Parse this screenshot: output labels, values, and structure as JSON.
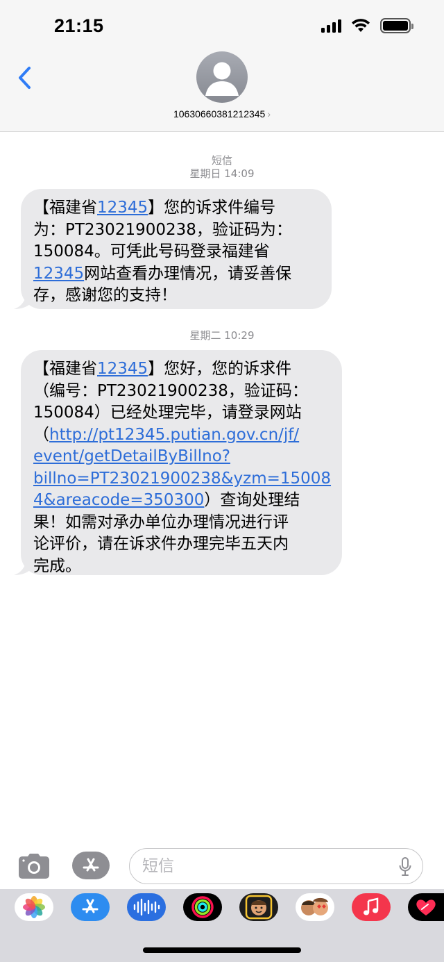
{
  "status_bar": {
    "time": "21:15"
  },
  "header": {
    "contact": "10630660381212345",
    "back_icon": "chevron-left-icon",
    "avatar_icon": "person-icon"
  },
  "thread": {
    "service_label": "短信",
    "timestamp_1": "星期日 14:09",
    "message_1": {
      "l1_a": "【福建省",
      "l1_link": "12345",
      "l1_b": "】您的诉求件编号",
      "l2": "为：PT23021900238，验证码为：",
      "l3": "150084。可凭此号码登录福建省",
      "l4_link": "12345",
      "l4_b": "网站查看办理情况，请妥善保",
      "l5": "存，感谢您的支持！"
    },
    "timestamp_2": "星期二 10:29",
    "message_2": {
      "l1_a": "【福建省",
      "l1_link": "12345",
      "l1_b": "】您好，您的诉求件",
      "l2": "（编号：PT23021900238，验证码：",
      "l3": "150084）已经处理完毕，请登录网站",
      "l4_a": "（",
      "l4_link": "http://pt12345.putian.gov.cn/jf/",
      "l5_link": "event/getDetailByBillno?",
      "l6_link": "billno=PT23021900238&yzm=15008",
      "l7_link": "4&areacode=350300",
      "l7_b": "）查询处理结",
      "l8": "果！如需对承办单位办理情况进行评",
      "l9": "论评价，请在诉求件办理完毕五天内",
      "l10": "完成。"
    }
  },
  "compose": {
    "placeholder": "短信",
    "camera_icon": "camera-icon",
    "apps_icon": "app-store-icon",
    "mic_icon": "microphone-icon"
  },
  "app_strip": [
    "photos-icon",
    "app-store-icon",
    "audio-message-icon",
    "activity-icon",
    "memoji-icon",
    "memoji-stickers-icon",
    "music-icon",
    "digital-touch-icon"
  ],
  "colors": {
    "link": "#2d6dd8",
    "bubble": "#e9e9eb",
    "accent": "#2f7cf6"
  }
}
